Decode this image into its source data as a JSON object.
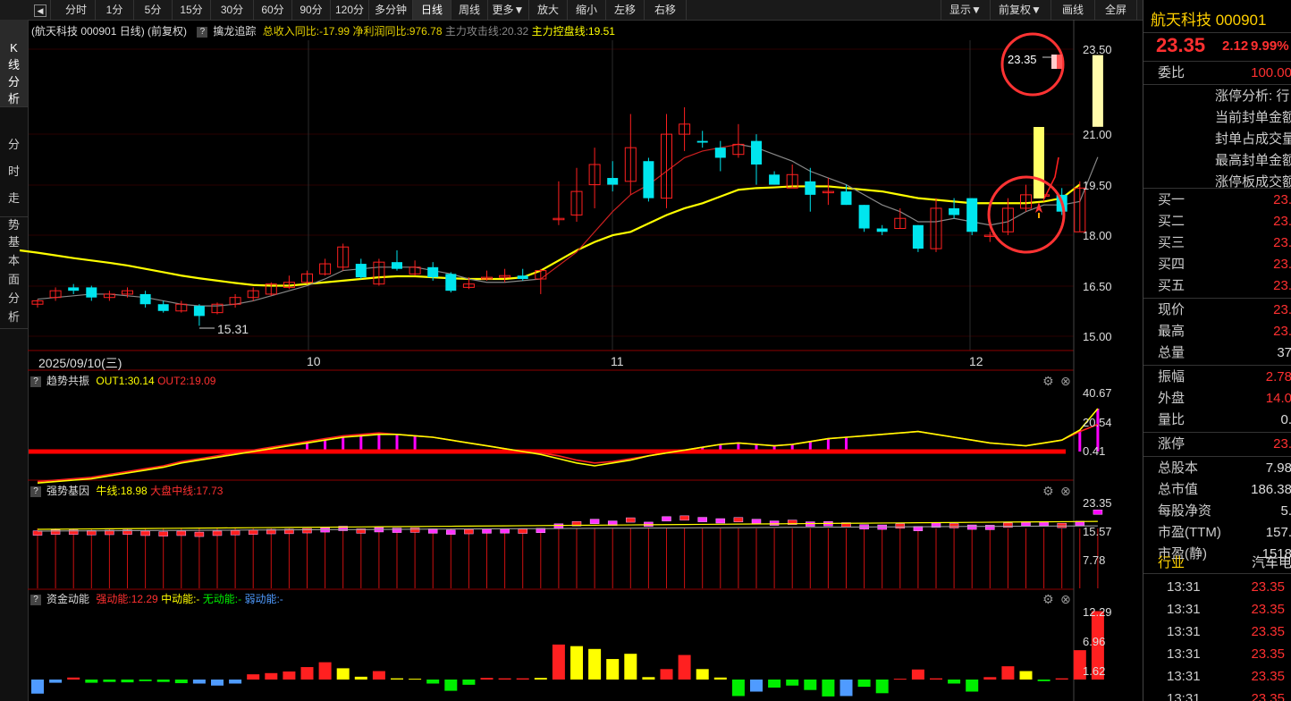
{
  "toolbar": {
    "back_icon": "triangle-left-icon",
    "periods": [
      "分时",
      "1分",
      "5分",
      "15分",
      "30分",
      "60分",
      "90分",
      "120分",
      "多分钟",
      "日线",
      "周线",
      "更多▼"
    ],
    "active_period": "日线",
    "tools": [
      "放大",
      "缩小",
      "左移",
      "右移"
    ],
    "right": [
      "显示▼",
      "前复权▼",
      "画线",
      "全屏"
    ]
  },
  "left_tabs": [
    {
      "label": "K线分析",
      "active": true
    },
    {
      "label": "分时走势",
      "active": false
    },
    {
      "label": "基本面分析",
      "active": false
    }
  ],
  "main_chart": {
    "title": "航天科技 000901 日线)  (前复权)",
    "indicator_name": "擒龙追踪",
    "indicators": [
      {
        "label": "总收入同比:-17.99",
        "color": "#e6d200"
      },
      {
        "label": "净利润同比:976.78",
        "color": "#e6d200"
      },
      {
        "label": "主力攻击线:20.32",
        "color": "#888888"
      },
      {
        "label": "主力控盘线:19.51",
        "color": "#ffff00"
      }
    ],
    "y_axis": [
      "23.50",
      "21.00",
      "19.50",
      "18.00",
      "16.50",
      "15.00"
    ],
    "low_label": "15.31",
    "high_label": "23.35",
    "x_axis": [
      "2025/09/10(三)",
      "10",
      "11",
      "12"
    ]
  },
  "panel1": {
    "name": "趋势共振",
    "out1": "OUT1:30.14",
    "out2": "OUT2:19.09",
    "y_axis": [
      "40.67",
      "20.54",
      "0.41"
    ]
  },
  "panel2": {
    "name": "强势基因",
    "a": "牛线:18.98",
    "b": "大盘中线:17.73",
    "y_axis": [
      "23.35",
      "15.57",
      "7.78"
    ]
  },
  "panel3": {
    "name": "资金动能",
    "a": "强动能:12.29",
    "b": "中动能:-",
    "c": "无动能:-",
    "d": "弱动能:-",
    "y_axis": [
      "12.29",
      "6.96",
      "1.62"
    ]
  },
  "colors": {
    "up": "#ff2020",
    "down": "#00e5ee",
    "ma_yellow": "#ffff00",
    "magenta": "#ff00ff"
  },
  "candles": [
    [
      15.95,
      16.05,
      15.85,
      16.1
    ],
    [
      16.15,
      16.35,
      16.05,
      16.45
    ],
    [
      16.45,
      16.35,
      16.25,
      16.55
    ],
    [
      16.45,
      16.15,
      16.05,
      16.5
    ],
    [
      16.15,
      16.25,
      16.05,
      16.35
    ],
    [
      16.25,
      16.35,
      16.15,
      16.45
    ],
    [
      16.25,
      15.95,
      15.85,
      16.35
    ],
    [
      15.95,
      15.75,
      15.7,
      16.05
    ],
    [
      15.75,
      15.95,
      15.7,
      16.05
    ],
    [
      15.9,
      15.6,
      15.31,
      15.95
    ],
    [
      15.7,
      15.95,
      15.65,
      16.0
    ],
    [
      15.95,
      16.15,
      15.85,
      16.25
    ],
    [
      16.15,
      16.35,
      16.05,
      16.45
    ],
    [
      16.25,
      16.55,
      16.2,
      16.6
    ],
    [
      16.45,
      16.6,
      16.4,
      16.8
    ],
    [
      16.6,
      16.85,
      16.55,
      16.95
    ],
    [
      16.85,
      17.15,
      16.8,
      17.3
    ],
    [
      17.05,
      17.65,
      16.95,
      17.75
    ],
    [
      17.15,
      16.75,
      16.7,
      17.3
    ],
    [
      16.55,
      17.2,
      16.5,
      17.3
    ],
    [
      17.2,
      17.0,
      16.95,
      17.55
    ],
    [
      16.85,
      17.05,
      16.8,
      17.25
    ],
    [
      17.05,
      16.75,
      16.65,
      17.2
    ],
    [
      16.85,
      16.35,
      16.3,
      16.9
    ],
    [
      16.45,
      16.55,
      16.4,
      16.75
    ],
    [
      16.7,
      16.75,
      16.65,
      16.95
    ],
    [
      16.75,
      16.8,
      16.6,
      17.0
    ],
    [
      16.8,
      16.7,
      16.65,
      17.0
    ],
    [
      16.7,
      16.95,
      16.25,
      17.0
    ],
    [
      18.5,
      18.5,
      18.3,
      19.6
    ],
    [
      18.6,
      19.3,
      18.4,
      20.0
    ],
    [
      19.5,
      20.1,
      18.8,
      20.6
    ],
    [
      19.7,
      19.5,
      19.3,
      20.2
    ],
    [
      19.6,
      20.6,
      19.2,
      21.6
    ],
    [
      20.2,
      19.1,
      19.0,
      20.3
    ],
    [
      19.1,
      21.0,
      18.8,
      21.6
    ],
    [
      21.0,
      21.3,
      20.5,
      21.8
    ],
    [
      20.8,
      20.75,
      20.6,
      21.1
    ],
    [
      20.6,
      20.3,
      19.9,
      20.8
    ],
    [
      20.4,
      20.7,
      20.3,
      21.3
    ],
    [
      20.8,
      20.1,
      19.5,
      21.0
    ],
    [
      19.8,
      19.5,
      19.5,
      19.9
    ],
    [
      19.4,
      19.8,
      19.4,
      20.1
    ],
    [
      19.6,
      19.2,
      18.7,
      20.0
    ],
    [
      19.3,
      19.3,
      18.9,
      19.7
    ],
    [
      19.3,
      18.9,
      18.9,
      19.5
    ],
    [
      18.9,
      18.2,
      18.1,
      18.9
    ],
    [
      18.2,
      18.1,
      18.0,
      18.3
    ],
    [
      18.2,
      18.5,
      18.2,
      18.8
    ],
    [
      18.3,
      17.6,
      17.5,
      18.3
    ],
    [
      17.6,
      18.8,
      17.5,
      19.1
    ],
    [
      18.8,
      18.6,
      18.5,
      19.1
    ],
    [
      19.1,
      18.1,
      18.0,
      19.1
    ],
    [
      18.0,
      18.0,
      17.8,
      18.1
    ],
    [
      18.1,
      18.8,
      18.0,
      19.1
    ],
    [
      18.8,
      19.2,
      18.7,
      19.5
    ],
    [
      19.2,
      19.2,
      19.0,
      19.6
    ],
    [
      19.2,
      18.7,
      18.6,
      19.4
    ],
    [
      18.1,
      19.4,
      18.1,
      19.6
    ],
    [
      21.22,
      23.35,
      21.22,
      23.35
    ]
  ],
  "chart_data": {
    "type": "line",
    "title": "航天科技 000901 日线",
    "series": [
      {
        "name": "主力控盘线",
        "values": [
          17.55,
          17.48,
          17.4,
          17.32,
          17.25,
          17.18,
          17.1,
          17.0,
          16.9,
          16.8,
          16.72,
          16.65,
          16.58,
          16.52,
          16.5,
          16.5,
          16.55,
          16.6,
          16.65,
          16.7,
          16.75,
          16.78,
          16.78,
          16.75,
          16.72,
          16.7,
          16.7,
          16.7,
          16.75,
          16.95,
          17.25,
          17.55,
          17.8,
          18.0,
          18.1,
          18.35,
          18.6,
          18.8,
          18.95,
          19.15,
          19.35,
          19.4,
          19.42,
          19.45,
          19.45,
          19.45,
          19.4,
          19.35,
          19.3,
          19.2,
          19.1,
          19.05,
          19.0,
          18.95,
          18.95,
          18.95,
          18.95,
          19.0,
          19.1,
          19.51
        ]
      },
      {
        "name": "主力攻击线",
        "values": [
          16.1,
          16.15,
          16.2,
          16.25,
          16.25,
          16.2,
          16.15,
          16.05,
          15.95,
          15.9,
          15.9,
          15.95,
          16.05,
          16.2,
          16.35,
          16.5,
          16.7,
          16.95,
          17.0,
          17.05,
          17.05,
          17.05,
          16.95,
          16.85,
          16.7,
          16.6,
          16.6,
          16.65,
          16.7,
          17.1,
          17.5,
          18.1,
          18.7,
          19.2,
          19.5,
          19.9,
          20.3,
          20.5,
          20.6,
          20.7,
          20.6,
          20.4,
          20.2,
          19.9,
          19.7,
          19.5,
          19.2,
          18.9,
          18.7,
          18.4,
          18.4,
          18.5,
          18.4,
          18.3,
          18.4,
          18.7,
          18.9,
          18.9,
          19.0,
          20.32
        ]
      }
    ]
  },
  "panel1_data": {
    "bars": [
      2,
      3,
      4,
      5,
      6,
      7,
      8,
      10,
      12,
      14,
      15,
      16,
      17,
      19,
      20,
      21,
      22,
      21,
      18,
      15,
      12,
      14,
      16,
      18,
      22,
      28,
      33,
      37,
      39,
      40
    ],
    "yellow": [
      -22,
      -21,
      -20,
      -19,
      -17,
      -15,
      -13,
      -11,
      -8,
      -6,
      -4,
      -2,
      0,
      2,
      4,
      6,
      8,
      10,
      11,
      12,
      12,
      11,
      10,
      8,
      6,
      4,
      2,
      0,
      -2,
      -5,
      -8,
      -10,
      -8,
      -6,
      -3,
      -1,
      1,
      3,
      5,
      6,
      5,
      4,
      5,
      7,
      9,
      10,
      11,
      12,
      13,
      14,
      12,
      10,
      8,
      6,
      5,
      4,
      6,
      8,
      15,
      30
    ],
    "red": [
      -21,
      -20,
      -19,
      -18,
      -16,
      -14,
      -12,
      -10,
      -7,
      -5,
      -3,
      -1,
      1,
      3,
      5,
      7,
      9,
      11,
      12,
      13,
      12,
      11,
      10,
      8,
      6,
      4,
      2,
      0,
      -1,
      -3,
      -6,
      -8,
      -7,
      -5,
      -3,
      -1,
      1,
      3,
      5,
      6,
      5,
      4,
      5,
      7,
      9,
      10,
      11,
      12,
      13,
      14,
      12,
      10,
      8,
      6,
      5,
      4,
      6,
      8,
      14,
      19
    ]
  },
  "panel3_vals": [
    [
      -3.5,
      "#4f9bff"
    ],
    [
      -0.8,
      "#4f9bff"
    ],
    [
      0.5,
      "#ff2020"
    ],
    [
      -0.8,
      "#00ee00"
    ],
    [
      -0.6,
      "#00ee00"
    ],
    [
      -0.7,
      "#00ee00"
    ],
    [
      -0.4,
      "#00ee00"
    ],
    [
      -0.6,
      "#00ee00"
    ],
    [
      -0.9,
      "#00ee00"
    ],
    [
      -1.0,
      "#4f9bff"
    ],
    [
      -1.5,
      "#4f9bff"
    ],
    [
      -1.0,
      "#4f9bff"
    ],
    [
      1.3,
      "#ff2020"
    ],
    [
      1.6,
      "#ff2020"
    ],
    [
      2.0,
      "#ff2020"
    ],
    [
      3.1,
      "#ff2020"
    ],
    [
      4.3,
      "#ff2020"
    ],
    [
      2.8,
      "#ffff00"
    ],
    [
      0.7,
      "#ffff00"
    ],
    [
      2.1,
      "#ff2020"
    ],
    [
      0.3,
      "#ffff00"
    ],
    [
      0.2,
      "#ffff00"
    ],
    [
      -1.0,
      "#00ee00"
    ],
    [
      -2.8,
      "#00ee00"
    ],
    [
      -1.3,
      "#00ee00"
    ],
    [
      0.4,
      "#ff2020"
    ],
    [
      0.3,
      "#ff2020"
    ],
    [
      0.3,
      "#ff2020"
    ],
    [
      0.4,
      "#ffff00"
    ],
    [
      8.7,
      "#ff2020"
    ],
    [
      8.3,
      "#ffff00"
    ],
    [
      7.6,
      "#ffff00"
    ],
    [
      5.1,
      "#ffff00"
    ],
    [
      6.4,
      "#ffff00"
    ],
    [
      0.6,
      "#ffff00"
    ],
    [
      2.6,
      "#ff2020"
    ],
    [
      6.1,
      "#ff2020"
    ],
    [
      2.6,
      "#ffff00"
    ],
    [
      0.5,
      "#ffff00"
    ],
    [
      -4.1,
      "#00ee00"
    ],
    [
      -3.0,
      "#4f9bff"
    ],
    [
      -2.0,
      "#00ee00"
    ],
    [
      -1.5,
      "#00ee00"
    ],
    [
      -2.6,
      "#00ee00"
    ],
    [
      -4.2,
      "#00ee00"
    ],
    [
      -4.1,
      "#4f9bff"
    ],
    [
      -1.8,
      "#00ee00"
    ],
    [
      -3.4,
      "#00ee00"
    ],
    [
      0.2,
      "#ff2020"
    ],
    [
      2.5,
      "#ff2020"
    ],
    [
      0.3,
      "#ff2020"
    ],
    [
      -1.0,
      "#00ee00"
    ],
    [
      -3.0,
      "#00ee00"
    ],
    [
      0.6,
      "#ff2020"
    ],
    [
      3.3,
      "#ff2020"
    ],
    [
      2.1,
      "#ffff00"
    ],
    [
      -0.4,
      "#00ee00"
    ],
    [
      0.3,
      "#ff2020"
    ],
    [
      7.3,
      "#ff2020"
    ],
    [
      17.0,
      "#ff2020"
    ]
  ],
  "right_panel": {
    "title": "航天科技 000901",
    "price": "23.35",
    "change": "2.12",
    "change_pct": "9.99%",
    "weibi_label": "委比",
    "weibi_value": "100.00",
    "limit_lines": [
      "涨停分析: 行",
      "当前封单金额",
      "封单占成交量",
      "最高封单金额",
      "涨停板成交额"
    ],
    "buys": [
      {
        "label": "买一",
        "value": "23."
      },
      {
        "label": "买二",
        "value": "23."
      },
      {
        "label": "买三",
        "value": "23."
      },
      {
        "label": "买四",
        "value": "23."
      },
      {
        "label": "买五",
        "value": "23."
      }
    ],
    "stats1": [
      {
        "label": "现价",
        "value": "23.",
        "color": "#ff3030"
      },
      {
        "label": "最高",
        "value": "23.",
        "color": "#ff3030"
      },
      {
        "label": "总量",
        "value": "37",
        "color": "#dddddd"
      }
    ],
    "stats2": [
      {
        "label": "振幅",
        "value": "2.78",
        "color": "#ff3030"
      },
      {
        "label": "外盘",
        "value": "14.0",
        "color": "#ff3030"
      },
      {
        "label": "量比",
        "value": "0.",
        "color": "#dddddd"
      }
    ],
    "stats3": [
      {
        "label": "涨停",
        "value": "23.",
        "color": "#ff3030"
      }
    ],
    "stats4": [
      {
        "label": "总股本",
        "value": "7.98",
        "color": "#dddddd"
      },
      {
        "label": "总市值",
        "value": "186.38",
        "color": "#dddddd"
      },
      {
        "label": "每股净资",
        "value": "5.",
        "color": "#dddddd"
      },
      {
        "label": "市盈(TTM)",
        "value": "157.",
        "color": "#dddddd"
      },
      {
        "label": "市盈(静)",
        "value": "1518",
        "color": "#dddddd"
      }
    ],
    "industry_label": "行业",
    "industry_value": "汽车电",
    "ticks": [
      {
        "time": "13:31",
        "price": "23.35"
      },
      {
        "time": "13:31",
        "price": "23.35"
      },
      {
        "time": "13:31",
        "price": "23.35"
      },
      {
        "time": "13:31",
        "price": "23.35"
      },
      {
        "time": "13:31",
        "price": "23.35"
      },
      {
        "time": "13:31",
        "price": "23.35"
      }
    ]
  }
}
